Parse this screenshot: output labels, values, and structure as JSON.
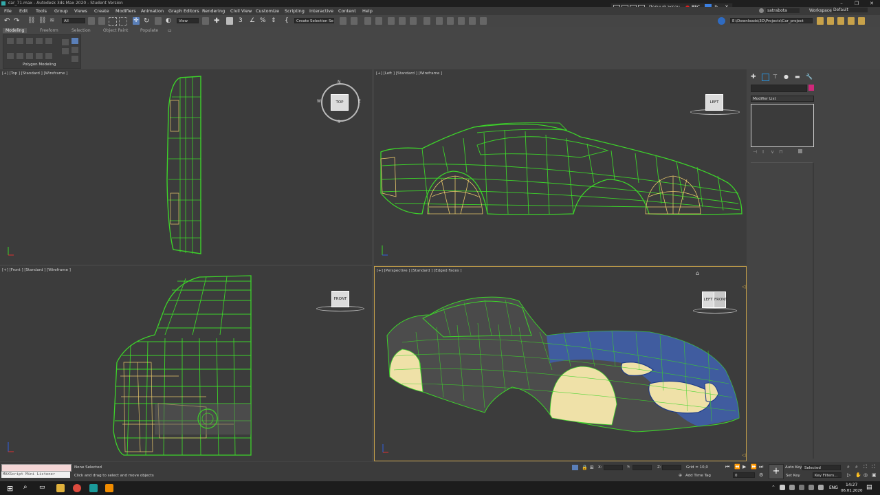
{
  "window": {
    "title": "car_71.max - Autodesk 3ds Max 2020 - Student Version",
    "recorder": {
      "fullscreen_label": "Полный экран",
      "rec_label": "REC"
    }
  },
  "menu": [
    "File",
    "Edit",
    "Tools",
    "Group",
    "Views",
    "Create",
    "Modifiers",
    "Animation",
    "Graph Editors",
    "Rendering",
    "Civil View",
    "Customize",
    "Scripting",
    "Interactive",
    "Content",
    "Help"
  ],
  "user": {
    "name": "satrabota",
    "workspaces_label": "Workspaces:",
    "workspace": "Default"
  },
  "toolbar": {
    "filter": "All",
    "view_dropdown": "View",
    "selection_set": "Create Selection Se",
    "project_path": "E:\\Downloads\\3D\\Projects\\Car_project"
  },
  "ribbon": {
    "tabs": [
      "Modeling",
      "Freeform",
      "Selection",
      "Object Paint",
      "Populate"
    ],
    "panel_label": "Polygon Modeling"
  },
  "viewports": {
    "top": {
      "label": "[+] [Top ] [Standard ] [Wireframe ]",
      "cube": "TOP",
      "compass": [
        "N",
        "W",
        "E",
        "S"
      ]
    },
    "left": {
      "label": "[+] [Left ] [Standard ] [Wireframe ]",
      "cube": "LEFT"
    },
    "front": {
      "label": "[+] [Front ] [Standard ] [Wireframe ]",
      "cube": "FRONT"
    },
    "perspective": {
      "label": "[+] [Perspective ] [Standard ] [Edged Faces ]",
      "cube_left": "LEFT",
      "cube_front": "FRONT"
    }
  },
  "command_panel": {
    "modifier_list": "Modifier List",
    "accent": "#d0287a"
  },
  "status": {
    "maxscript": "MAXScript Mini Listener",
    "selection": "None Selected",
    "prompt": "Click and drag to select and move objects",
    "x_label": "X:",
    "y_label": "Y:",
    "z_label": "Z:",
    "grid": "Grid = 10,0",
    "add_time_tag": "Add Time Tag",
    "frame": "0",
    "auto_key": "Auto Key",
    "set_key": "Set Key",
    "selected": "Selected",
    "key_filters": "Key Filters..."
  },
  "taskbar": {
    "lang": "ENG",
    "time": "14:27",
    "date": "06.01.2020"
  },
  "colors": {
    "wire": "#3dd42a",
    "wire_yellow": "#e8c86a",
    "body_blue": "#3e5fae",
    "wheel_cream": "#efe1a8",
    "viewport": "#3c3c3c",
    "active_border": "#c8a24a"
  }
}
